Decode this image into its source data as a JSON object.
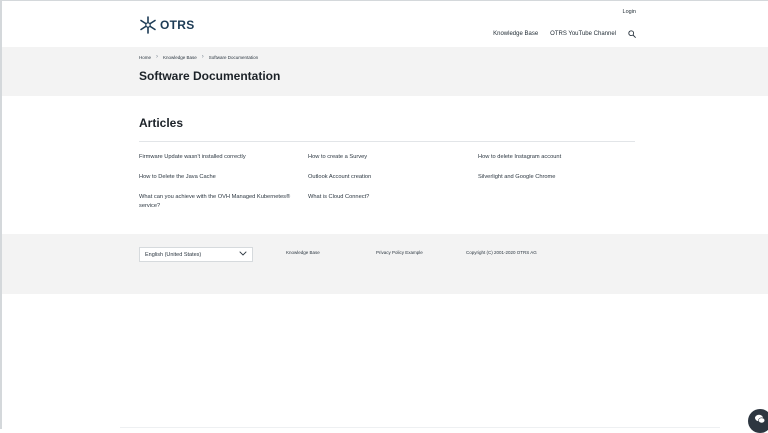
{
  "header": {
    "logo_text": "OTRS",
    "login_label": "Login",
    "nav": [
      "Knowledge Base",
      "OTRS YouTube Channel"
    ]
  },
  "hero": {
    "breadcrumb": [
      "Home",
      "Knowledge Base",
      "Software Documentation"
    ],
    "title": "Software Documentation"
  },
  "articles": {
    "heading": "Articles",
    "items": [
      "Firmware Update wasn't installed correctly",
      "How to create a Survey",
      "How to delete Instagram account",
      "How to Delete the Java Cache",
      "Outlook Account creation",
      "Silverlight and Google Chrome",
      "What can you achieve with the OVH Managed Kubernetes® service?",
      "What is Cloud Connect?"
    ]
  },
  "footer": {
    "language_value": "English (United States)",
    "links": [
      "Knowledge Base",
      "Privacy Policy Example"
    ],
    "copyright": "Copyright (C) 2001-2020 OTRS AG"
  },
  "icons": {
    "logo": "otrs-star-logo-icon",
    "search": "search-icon",
    "chevron": "chevron-down-icon",
    "chat": "chat-icon"
  },
  "colors": {
    "brand": "#1c3b55",
    "band_background": "#f3f3f3"
  }
}
